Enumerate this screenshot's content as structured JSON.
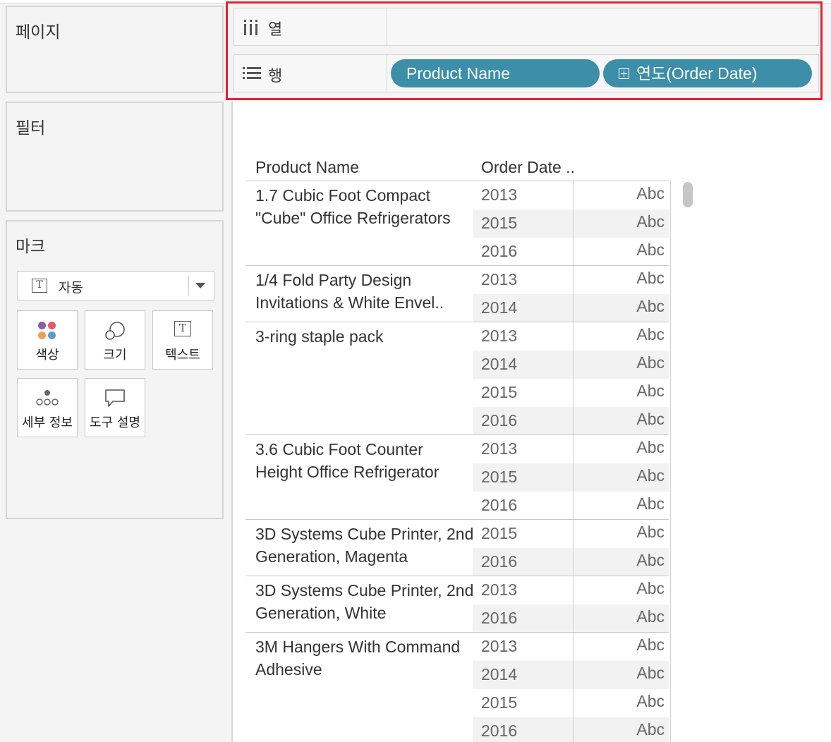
{
  "panels": {
    "pages": "페이지",
    "filters": "필터",
    "marks": "마크"
  },
  "marks": {
    "type_selected": "자동",
    "type_icon": "text-type-icon",
    "buttons": [
      {
        "label": "색상",
        "icon": "color-icon"
      },
      {
        "label": "크기",
        "icon": "size-icon"
      },
      {
        "label": "텍스트",
        "icon": "text-icon"
      },
      {
        "label": "세부 정보",
        "icon": "detail-icon"
      },
      {
        "label": "도구 설명",
        "icon": "tooltip-icon"
      }
    ]
  },
  "shelves": {
    "columns_label": "열",
    "rows_label": "행",
    "row_pills": [
      "Product Name",
      "연도(Order Date)"
    ],
    "highlight_color": "#e12432",
    "pill_color": "#3c8ea9"
  },
  "view": {
    "headers": [
      "Product Name",
      "Order Date .."
    ],
    "cell_text": "Abc",
    "rows": [
      {
        "name": "1.7 Cubic Foot Compact \"Cube\" Office Refrigerators",
        "years": [
          "2013",
          "2015",
          "2016"
        ]
      },
      {
        "name": "1/4 Fold Party Design Invitations & White Envel..",
        "years": [
          "2013",
          "2014"
        ]
      },
      {
        "name": "3-ring staple pack",
        "years": [
          "2013",
          "2014",
          "2015",
          "2016"
        ]
      },
      {
        "name": "3.6 Cubic Foot Counter Height Office Refrigerator",
        "years": [
          "2013",
          "2015",
          "2016"
        ]
      },
      {
        "name": "3D Systems Cube Printer, 2nd Generation, Magenta",
        "years": [
          "2015",
          "2016"
        ]
      },
      {
        "name": "3D Systems Cube Printer, 2nd Generation, White",
        "years": [
          "2013",
          "2016"
        ]
      },
      {
        "name": "3M Hangers With Command Adhesive",
        "years": [
          "2013",
          "2014",
          "2015",
          "2016"
        ]
      }
    ]
  }
}
